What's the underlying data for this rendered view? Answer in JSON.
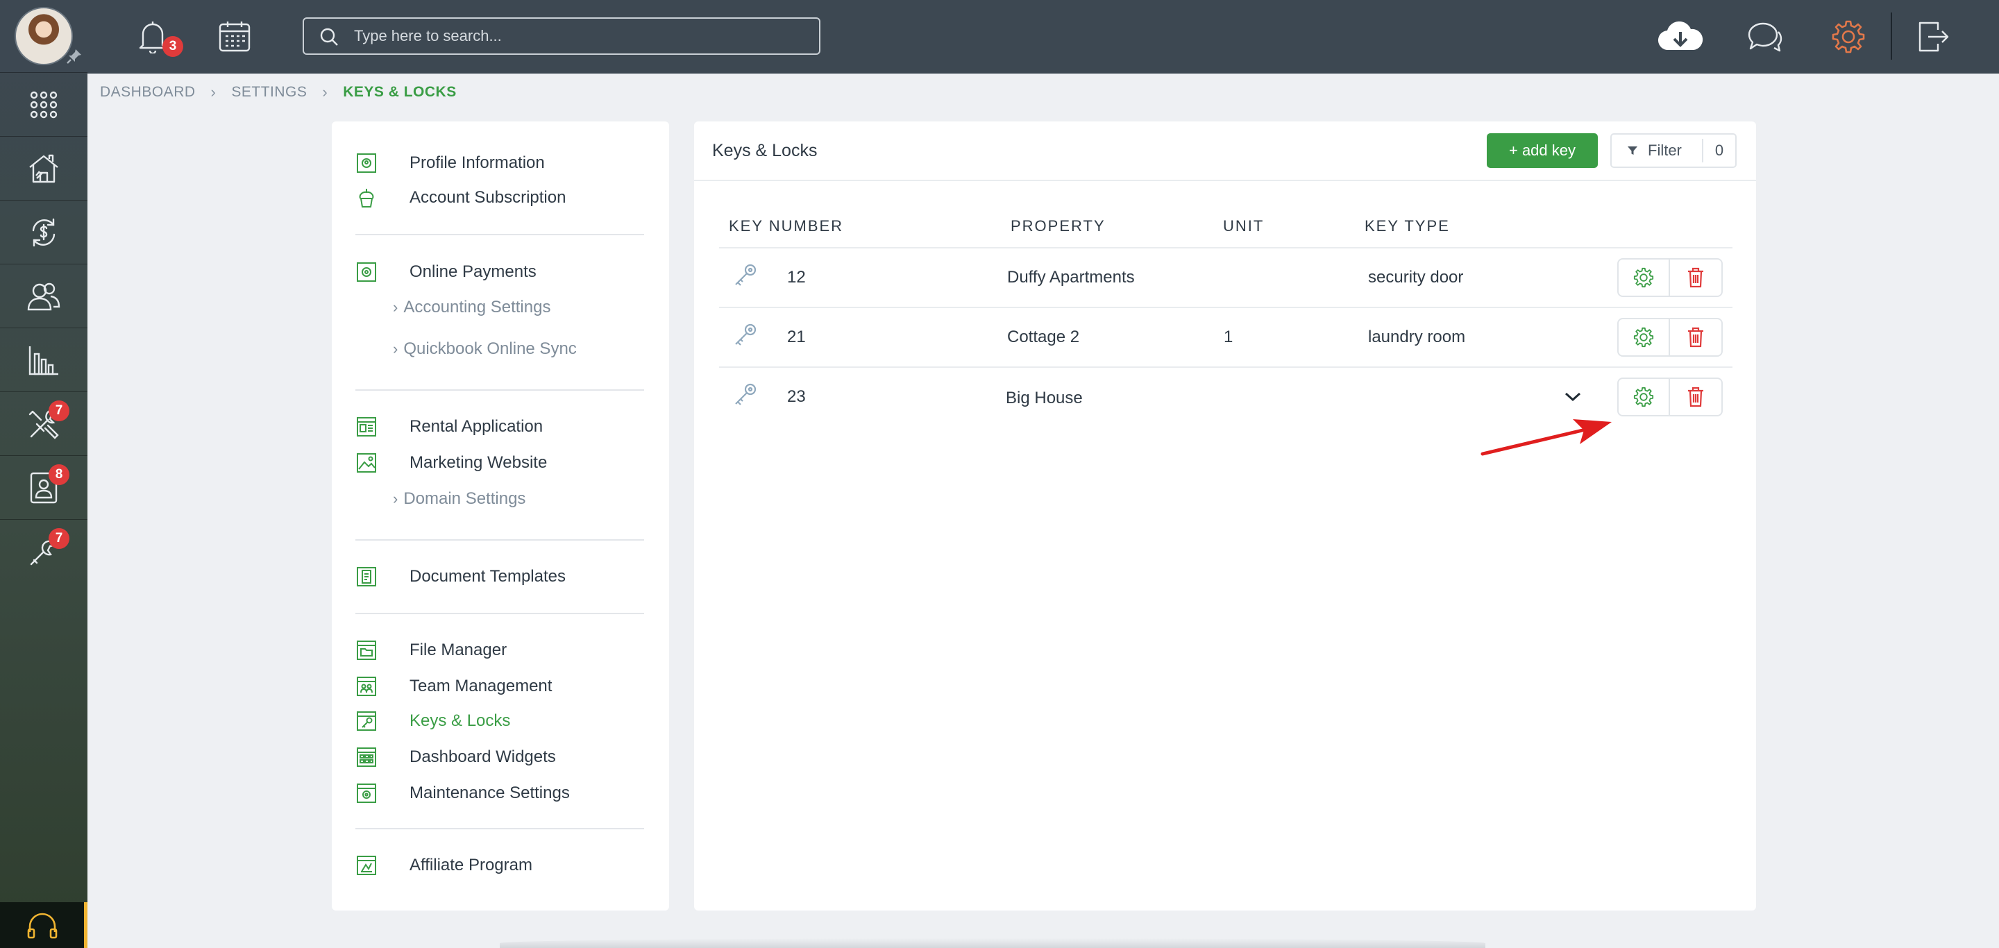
{
  "topbar": {
    "notification_count": "3",
    "search_placeholder": "Type here to search..."
  },
  "sidebar": {
    "badges": {
      "maintenance": "7",
      "tenants": "8",
      "tools": "7"
    }
  },
  "breadcrumb": {
    "items": [
      "DASHBOARD",
      "SETTINGS",
      "KEYS & LOCKS"
    ]
  },
  "settings_menu": {
    "profile_information": "Profile Information",
    "account_subscription": "Account Subscription",
    "online_payments": "Online Payments",
    "accounting_settings": "Accounting Settings",
    "quickbook_online_sync": "Quickbook Online Sync",
    "rental_application": "Rental Application",
    "marketing_website": "Marketing Website",
    "domain_settings": "Domain Settings",
    "document_templates": "Document Templates",
    "file_manager": "File Manager",
    "team_management": "Team Management",
    "keys_locks": "Keys & Locks",
    "dashboard_widgets": "Dashboard Widgets",
    "maintenance_settings": "Maintenance Settings",
    "affiliate_program": "Affiliate Program"
  },
  "keys_card": {
    "title": "Keys & Locks",
    "add_key_label": "+ add key",
    "filter_label": "Filter",
    "filter_count": "0",
    "columns": {
      "key_number": "KEY NUMBER",
      "property": "PROPERTY",
      "unit": "UNIT",
      "key_type": "KEY TYPE"
    },
    "rows": [
      {
        "key_number": "12",
        "property": "Duffy Apartments",
        "unit": "",
        "key_type": "security door"
      },
      {
        "key_number": "21",
        "property": "Cottage 2",
        "unit": "1",
        "key_type": "laundry room"
      },
      {
        "key_number": "23",
        "property": "Big House",
        "unit": "",
        "key_type": ""
      }
    ]
  },
  "colors": {
    "accent_green": "#3a9d45",
    "danger_red": "#e03b3b",
    "settings_orange": "#e2784a",
    "topbar": "#3d4852"
  }
}
